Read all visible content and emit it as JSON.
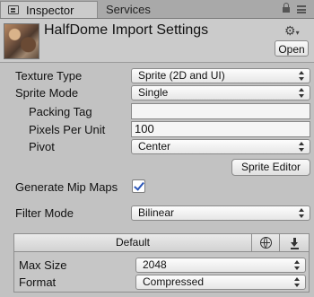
{
  "tabs": [
    {
      "label": "Inspector",
      "active": true
    },
    {
      "label": "Services",
      "active": false
    }
  ],
  "header": {
    "title": "HalfDome Import Settings",
    "open_label": "Open"
  },
  "settings": {
    "texture_type": {
      "label": "Texture Type",
      "value": "Sprite (2D and UI)"
    },
    "sprite_mode": {
      "label": "Sprite Mode",
      "value": "Single"
    },
    "packing_tag": {
      "label": "Packing Tag",
      "value": ""
    },
    "pixels_per_unit": {
      "label": "Pixels Per Unit",
      "value": "100"
    },
    "pivot": {
      "label": "Pivot",
      "value": "Center"
    },
    "sprite_editor_label": "Sprite Editor",
    "generate_mip_maps": {
      "label": "Generate Mip Maps",
      "checked": true
    },
    "filter_mode": {
      "label": "Filter Mode",
      "value": "Bilinear"
    }
  },
  "platform": {
    "default_tab": "Default",
    "max_size": {
      "label": "Max Size",
      "value": "2048"
    },
    "format": {
      "label": "Format",
      "value": "Compressed"
    }
  },
  "colors": {
    "background": "#c2c2c2",
    "checkmark": "#2b56b8"
  },
  "icons": [
    "inspector-icon",
    "lock-icon",
    "menu-icon",
    "gear-icon",
    "globe-icon",
    "download-icon",
    "chevron-updown-icon"
  ]
}
